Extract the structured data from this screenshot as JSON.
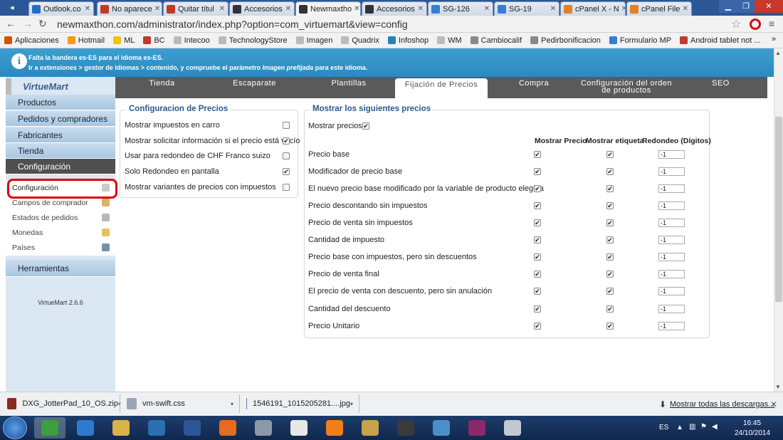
{
  "browser": {
    "tabs": [
      {
        "label": "Outlook.co",
        "color": "#1f6fc7"
      },
      {
        "label": "No aparece",
        "color": "#c0392b"
      },
      {
        "label": "Quitar títul",
        "color": "#c0392b"
      },
      {
        "label": "Accesorios",
        "color": "#333333"
      },
      {
        "label": "Newmaxtho",
        "color": "#333333"
      },
      {
        "label": "Accesorios",
        "color": "#333333"
      },
      {
        "label": "SG-126",
        "color": "#3a7bd5"
      },
      {
        "label": "SG-19",
        "color": "#3a7bd5"
      },
      {
        "label": "cPanel X - N",
        "color": "#e67e22"
      },
      {
        "label": "cPanel File",
        "color": "#e67e22"
      }
    ],
    "url": "newmaxthon.com/administrator/index.php?option=com_virtuemart&view=config",
    "bookmarks": [
      {
        "label": "Aplicaciones",
        "color": "#d35400"
      },
      {
        "label": "Hotmail",
        "color": "#f39c12"
      },
      {
        "label": "ML",
        "color": "#f1c40f"
      },
      {
        "label": "BC",
        "color": "#c0392b"
      },
      {
        "label": "Intecoo",
        "color": "#bbbbbb"
      },
      {
        "label": "TechnologyStore",
        "color": "#bbbbbb"
      },
      {
        "label": "Imagen",
        "color": "#bbbbbb"
      },
      {
        "label": "Quadrix",
        "color": "#bbbbbb"
      },
      {
        "label": "Infoshop",
        "color": "#2980b9"
      },
      {
        "label": "WM",
        "color": "#bbbbbb"
      },
      {
        "label": "Cambiocalif",
        "color": "#888888"
      },
      {
        "label": "Pedirbonificacion",
        "color": "#888888"
      },
      {
        "label": "Formulario MP",
        "color": "#3a7bd5"
      },
      {
        "label": "Android tablet not ...",
        "color": "#c0392b"
      }
    ]
  },
  "notice": {
    "line1": "Falta la bandera es-ES para el idioma es-ES.",
    "line2_prefix": "Ir a extensiones > gestor de idiomas > contenido, y compruebe el parámetro",
    "line2_em": "Imagen prefijada",
    "line2_suffix": "para este idioma."
  },
  "sidebar": {
    "logo": "VirtueMart",
    "items": [
      "Productos",
      "Pedidos y compradores",
      "Fabricantes",
      "Tienda",
      "Configuración"
    ],
    "subitems": [
      "Configuración",
      "Campos de comprador",
      "Estados de pedidos",
      "Monedas",
      "Países"
    ],
    "tools": "Herramientas",
    "version": "VirtueMart 2.6.6"
  },
  "toptabs": [
    "Tienda",
    "Escaparate",
    "Plantillas",
    "Fijación de Precios",
    "Compra",
    "Configuración del orden",
    "de productos",
    "SEO"
  ],
  "pricing_config": {
    "title": "Configuracion de Precios",
    "rows": [
      {
        "label": "Mostrar impuestos en carro",
        "checked": false
      },
      {
        "label": "Mostrar solicitar información si el precio está vacío",
        "checked": true
      },
      {
        "label": "Usar para redondeo de CHF Franco suizo",
        "checked": false
      },
      {
        "label": "Solo Redondeo en pantalla",
        "checked": true
      },
      {
        "label": "Mostrar variantes de precios con impuestos",
        "checked": false
      }
    ]
  },
  "show_prices": {
    "title": "Mostrar los siguientes precios",
    "toggle_label": "Mostrar precios",
    "toggle_checked": true,
    "columns": [
      "Mostrar Precio",
      "Mostrar etiqueta",
      "Redondeo (Dígitos)"
    ],
    "rows": [
      {
        "label": "Precio base",
        "show": true,
        "tag": true,
        "round": "-1"
      },
      {
        "label": "Modificador de precio base",
        "show": true,
        "tag": true,
        "round": "-1"
      },
      {
        "label": "El nuevo precio base modificado por la variable de producto elegida",
        "show": true,
        "tag": true,
        "round": "-1"
      },
      {
        "label": "Precio descontando sin impuestos",
        "show": true,
        "tag": true,
        "round": "-1"
      },
      {
        "label": "Precio de venta sin impuestos",
        "show": true,
        "tag": true,
        "round": "-1"
      },
      {
        "label": "Cantidad de impuesto",
        "show": true,
        "tag": true,
        "round": "-1"
      },
      {
        "label": "Precio base con impuestos, pero sin descuentos",
        "show": true,
        "tag": true,
        "round": "-1"
      },
      {
        "label": "Precio de venta final",
        "show": true,
        "tag": true,
        "round": "-1"
      },
      {
        "label": "El precio de venta con descuento, pero sin anulación",
        "show": true,
        "tag": true,
        "round": "-1"
      },
      {
        "label": "Cantidad del descuento",
        "show": true,
        "tag": true,
        "round": "-1"
      },
      {
        "label": "Precio Unitario",
        "show": true,
        "tag": true,
        "round": "-1"
      }
    ]
  },
  "downloads": {
    "items": [
      "DXG_JotterPad_10_OS.zip",
      "vm-swift.css",
      "1546191_1015205281....jpg"
    ],
    "show_all": "Mostrar todas las descargas..."
  },
  "taskbar": {
    "apps": [
      "chrome",
      "ie",
      "explorer",
      "media",
      "word",
      "firefox",
      "recycle",
      "inkscape",
      "n-app",
      "coin",
      "studio",
      "talk",
      "winrar",
      "scanner"
    ],
    "lang": "ES",
    "time": "16:45",
    "date": "24/10/2014"
  }
}
